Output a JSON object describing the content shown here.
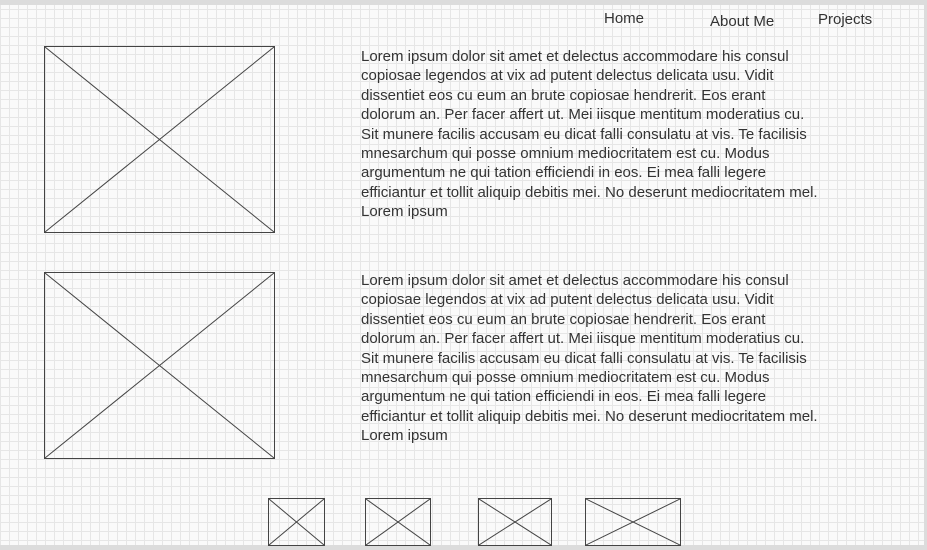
{
  "nav": {
    "home_label": "Home",
    "about_label": "About Me",
    "projects_label": "Projects"
  },
  "sections": [
    {
      "image_icon": "image-placeholder-icon",
      "text": "Lorem ipsum dolor sit amet et delectus accommodare his consul copiosae legendos at vix ad putent delectus delicata usu. Vidit dissentiet eos cu eum an brute copiosae hendrerit. Eos erant dolorum an. Per facer affert ut. Mei iisque mentitum moderatius cu. Sit munere facilis accusam eu dicat falli consulatu at vis. Te facilisis mnesarchum qui posse omnium mediocritatem est cu. Modus argumentum ne qui tation efficiendi in eos. Ei mea falli legere efficiantur et tollit aliquip debitis mei. No deserunt mediocritatem mel. Lorem ipsum"
    },
    {
      "image_icon": "image-placeholder-icon",
      "text": "Lorem ipsum dolor sit amet et delectus accommodare his consul copiosae legendos at vix ad putent delectus delicata usu. Vidit dissentiet eos cu eum an brute copiosae hendrerit. Eos erant dolorum an. Per facer affert ut. Mei iisque mentitum moderatius cu. Sit munere facilis accusam eu dicat falli consulatu at vis. Te facilisis mnesarchum qui posse omnium mediocritatem est cu. Modus argumentum ne qui tation efficiendi in eos. Ei mea falli legere efficiantur et tollit aliquip debitis mei. No deserunt mediocritatem mel. Lorem ipsum"
    }
  ],
  "thumbnails": [
    {
      "icon": "image-placeholder-icon"
    },
    {
      "icon": "image-placeholder-icon"
    },
    {
      "icon": "image-placeholder-icon"
    },
    {
      "icon": "image-placeholder-icon"
    }
  ],
  "colors": {
    "grid_line": "#e6e6e6",
    "background": "#fafafa",
    "stroke": "#444444",
    "text": "#333333"
  }
}
